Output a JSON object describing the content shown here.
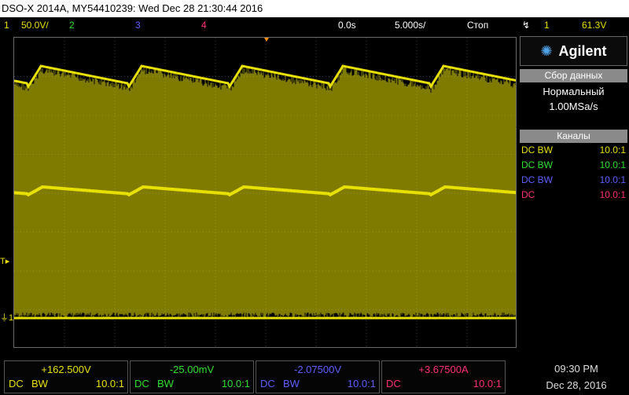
{
  "title": "DSO-X 2014A, MY54410239: Wed Dec 28 21:30:44 2016",
  "status": {
    "ch1_num": "1",
    "ch1_scale": "50.0V/",
    "ch2_num": "2",
    "ch3_num": "3",
    "ch4_num": "4",
    "time_offset": "0.0s",
    "time_scale": "5.000s/",
    "run_state": "Стоп",
    "trigger_icon": "↯",
    "trigger_ch": "1",
    "trigger_level": "61.3V"
  },
  "markers": {
    "trigger_label": "T",
    "ground_label": "1"
  },
  "brand": {
    "name": "Agilent",
    "logo": "spark-logo"
  },
  "acquisition": {
    "header": "Сбор данных",
    "mode": "Нормальный",
    "rate": "1.00MSa/s"
  },
  "channels_panel": {
    "header": "Каналы",
    "rows": [
      {
        "coupling": "DC BW",
        "ratio": "10.0:1",
        "color": "#e8e000"
      },
      {
        "coupling": "DC BW",
        "ratio": "10.0:1",
        "color": "#2ee02e"
      },
      {
        "coupling": "DC BW",
        "ratio": "10.0:1",
        "color": "#5f5fff"
      },
      {
        "coupling": "DC",
        "ratio": "10.0:1",
        "color": "#ff2f7a"
      }
    ]
  },
  "bottom_channels": [
    {
      "value": "+162.500V",
      "coupling": "DC",
      "bw": "BW",
      "ratio": "10.0:1",
      "color": "#e8e000"
    },
    {
      "value": "-25.00mV",
      "coupling": "DC",
      "bw": "BW",
      "ratio": "10.0:1",
      "color": "#2ee02e"
    },
    {
      "value": "-2.07500V",
      "coupling": "DC",
      "bw": "BW",
      "ratio": "10.0:1",
      "color": "#5f5fff"
    },
    {
      "value": "+3.67500A",
      "coupling": "DC",
      "bw": "",
      "ratio": "10.0:1",
      "color": "#ff2f7a"
    }
  ],
  "clock": {
    "time": "09:30 PM",
    "date": "Dec 28, 2016"
  },
  "trace_color": "#e8e000"
}
